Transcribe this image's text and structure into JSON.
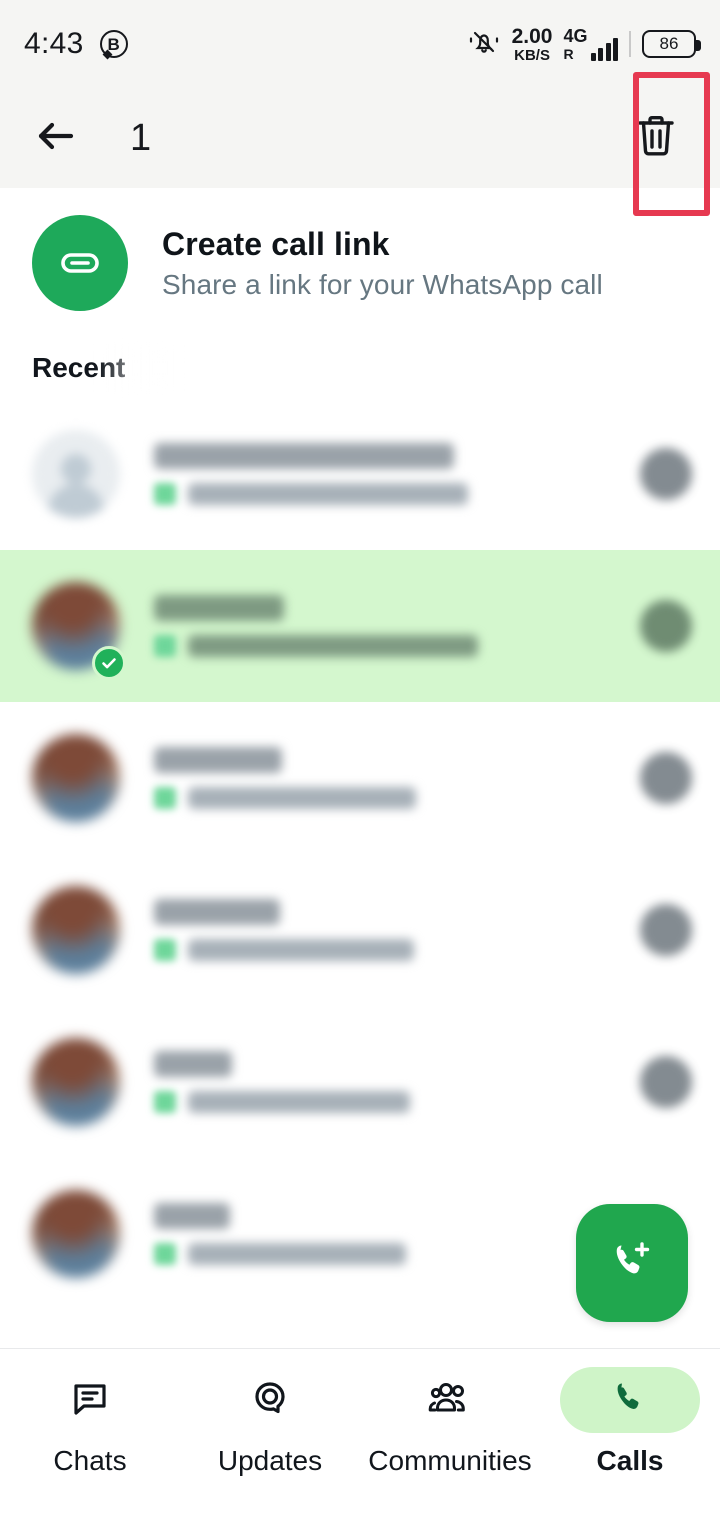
{
  "status_bar": {
    "time": "4:43",
    "badge_letter": "B",
    "silent_icon": "bell-slash-icon",
    "network_speed_value": "2.00",
    "network_speed_unit": "KB/S",
    "network_type": "4G",
    "roaming": "R",
    "signal_icon": "signal-bars-icon",
    "battery_level": "86"
  },
  "app_bar": {
    "back_icon": "back-arrow-icon",
    "selection_count": "1",
    "delete_icon": "trash-icon"
  },
  "annotation": {
    "color": "#E63950",
    "target": "delete-button"
  },
  "call_link": {
    "icon": "link-icon",
    "title": "Create call link",
    "subtitle": "Share a link for your WhatsApp call",
    "circle_color": "#1EA95A"
  },
  "section": {
    "recent_label": "Recent"
  },
  "calls": [
    {
      "name": "",
      "meta": "",
      "avatar": "contact-default",
      "selected": false,
      "trailing_icon": "call-type-icon"
    },
    {
      "name": "",
      "meta": "",
      "avatar": "photo",
      "selected": true,
      "trailing_icon": "call-type-icon"
    },
    {
      "name": "",
      "meta": "",
      "avatar": "photo",
      "selected": false,
      "trailing_icon": "call-type-icon"
    },
    {
      "name": "",
      "meta": "",
      "avatar": "photo",
      "selected": false,
      "trailing_icon": "call-type-icon"
    },
    {
      "name": "",
      "meta": "",
      "avatar": "photo",
      "selected": false,
      "trailing_icon": "call-type-icon"
    },
    {
      "name": "",
      "meta": "",
      "avatar": "photo",
      "selected": false,
      "trailing_icon": "call-type-icon"
    }
  ],
  "fab": {
    "icon": "phone-add-icon",
    "color": "#20A74E"
  },
  "bottom_nav": {
    "items": [
      {
        "label": "Chats",
        "icon": "chats-icon",
        "active": false
      },
      {
        "label": "Updates",
        "icon": "updates-icon",
        "active": false
      },
      {
        "label": "Communities",
        "icon": "communities-icon",
        "active": false
      },
      {
        "label": "Calls",
        "icon": "phone-icon",
        "active": true
      }
    ],
    "active_pill_color": "#CFF4C8"
  }
}
